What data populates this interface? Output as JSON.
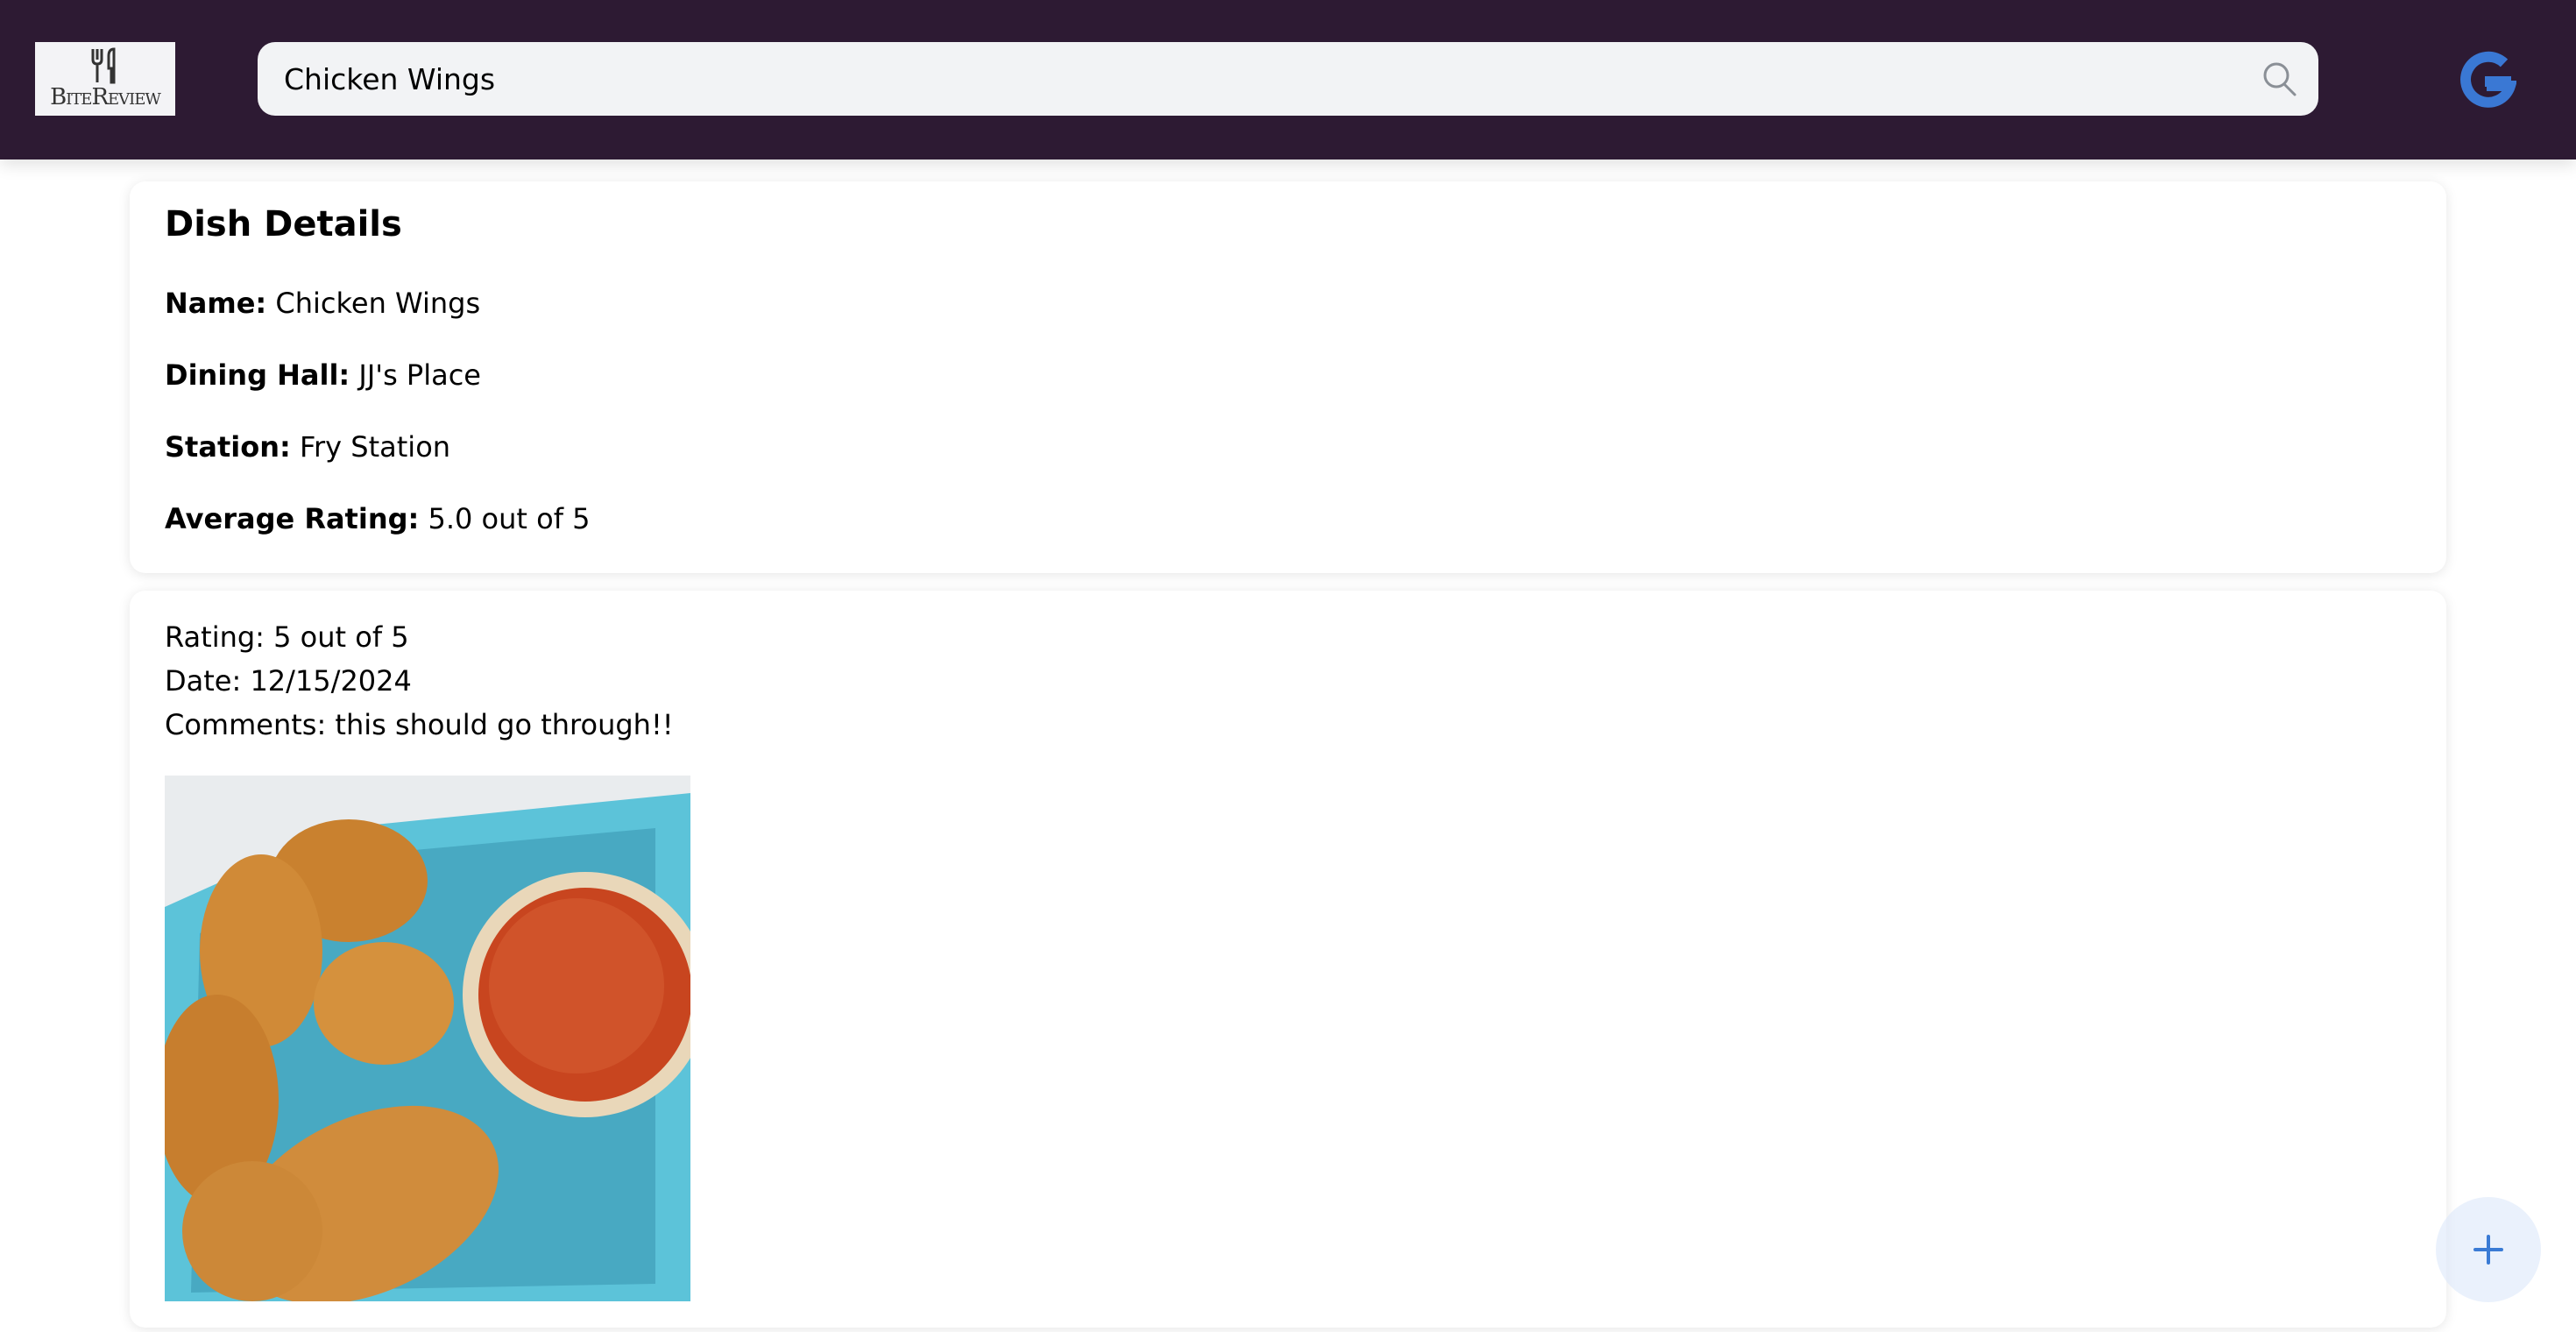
{
  "header": {
    "logo_text": "BiteReview",
    "search_value": "Chicken Wings",
    "search_icon": "search-icon",
    "account_icon": "google-icon",
    "google_color": "#3a78d4"
  },
  "dish": {
    "title": "Dish Details",
    "name_label": "Name:",
    "name": "Chicken Wings",
    "hall_label": "Dining Hall:",
    "hall": "JJ's Place",
    "station_label": "Station:",
    "station": "Fry Station",
    "avg_label": "Average Rating:",
    "avg": "5.0 out of 5"
  },
  "review": {
    "rating": "Rating: 5 out of 5",
    "date": "Date: 12/15/2024",
    "comments": "Comments: this should go through!!"
  },
  "fab": {
    "icon": "plus-icon",
    "color": "#3a7bd5"
  }
}
